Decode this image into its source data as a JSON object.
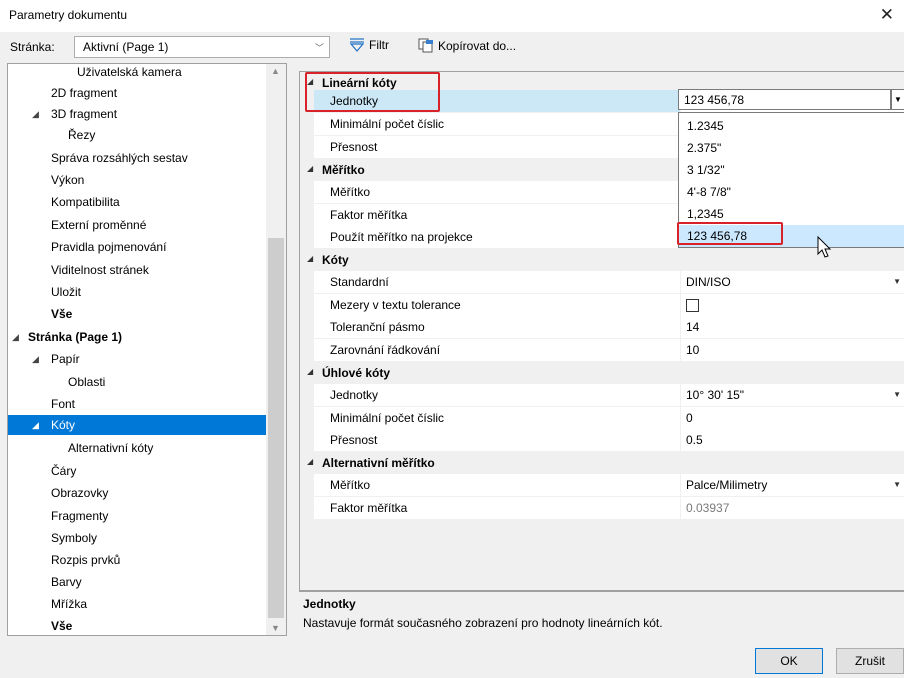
{
  "window": {
    "title": "Parametry dokumentu",
    "close_glyph": "✕"
  },
  "toolbar": {
    "page_label": "Stránka:",
    "page_value": "Aktivní (Page 1)",
    "filter_label": "Filtr",
    "copy_label": "Kopírovat do..."
  },
  "tree": {
    "items": [
      {
        "label": "Uživatelská kamera"
      },
      {
        "label": "2D fragment"
      },
      {
        "label": "3D fragment",
        "expander": "◢"
      },
      {
        "label": "Řezy"
      },
      {
        "label": "Správa rozsáhlých sestav"
      },
      {
        "label": "Výkon"
      },
      {
        "label": "Kompatibilita"
      },
      {
        "label": "Externí proměnné"
      },
      {
        "label": "Pravidla pojmenování"
      },
      {
        "label": "Viditelnost stránek"
      },
      {
        "label": "Uložit"
      },
      {
        "label": "Vše"
      },
      {
        "label": "Stránka (Page 1)",
        "expander": "◢"
      },
      {
        "label": "Papír",
        "expander": "◢"
      },
      {
        "label": "Oblasti"
      },
      {
        "label": "Font"
      },
      {
        "label": "Kóty",
        "expander": "◢"
      },
      {
        "label": "Alternativní kóty"
      },
      {
        "label": "Čáry"
      },
      {
        "label": "Obrazovky"
      },
      {
        "label": "Fragmenty"
      },
      {
        "label": "Symboly"
      },
      {
        "label": "Rozpis prvků"
      },
      {
        "label": "Barvy"
      },
      {
        "label": "Mřížka"
      },
      {
        "label": "Vše"
      }
    ],
    "scroll_up": "▲",
    "scroll_down": "▼"
  },
  "grid": {
    "rows": [
      {
        "name": "Lineární kóty",
        "expander": "◢"
      },
      {
        "name": "Jednotky",
        "value": "123 456,78"
      },
      {
        "name": "Minimální počet číslic",
        "value": ""
      },
      {
        "name": "Přesnost",
        "value": ""
      },
      {
        "name": "Měřítko",
        "expander": "◢"
      },
      {
        "name": "Měřítko",
        "value": ""
      },
      {
        "name": "Faktor měřítka",
        "value": ""
      },
      {
        "name": "Použít měřítko na projekce",
        "value": ""
      },
      {
        "name": "Kóty",
        "expander": "◢"
      },
      {
        "name": "Standardní",
        "value": "DIN/ISO",
        "dropdown": "▼"
      },
      {
        "name": "Mezery v textu tolerance",
        "value": ""
      },
      {
        "name": "Toleranční pásmo",
        "value": "14"
      },
      {
        "name": "Zarovnání řádkování",
        "value": "10"
      },
      {
        "name": "Úhlové kóty",
        "expander": "◢"
      },
      {
        "name": "Jednotky",
        "value": "10° 30' 15\"",
        "dropdown": "▼"
      },
      {
        "name": "Minimální počet číslic",
        "value": "0"
      },
      {
        "name": "Přesnost",
        "value": "0.5"
      },
      {
        "name": "Alternativní měřítko",
        "expander": "◢"
      },
      {
        "name": "Měřítko",
        "value": "Palce/Milimetry",
        "dropdown": "▼"
      },
      {
        "name": "Faktor měřítka",
        "value": "0.03937"
      }
    ],
    "dropdown_button": "▼"
  },
  "dropdown": {
    "options": [
      "1.2345",
      "2.375\"",
      "3 1/32\"",
      "4'-8 7/8\"",
      "1,2345",
      "123 456,78"
    ]
  },
  "description": {
    "title": "Jednotky",
    "text": "Nastavuje formát současného zobrazení pro hodnoty lineárních kót."
  },
  "buttons": {
    "ok": "OK",
    "cancel": "Zrušit"
  },
  "colors": {
    "selection": "#0078d7",
    "highlight_box": "#d9212a"
  }
}
